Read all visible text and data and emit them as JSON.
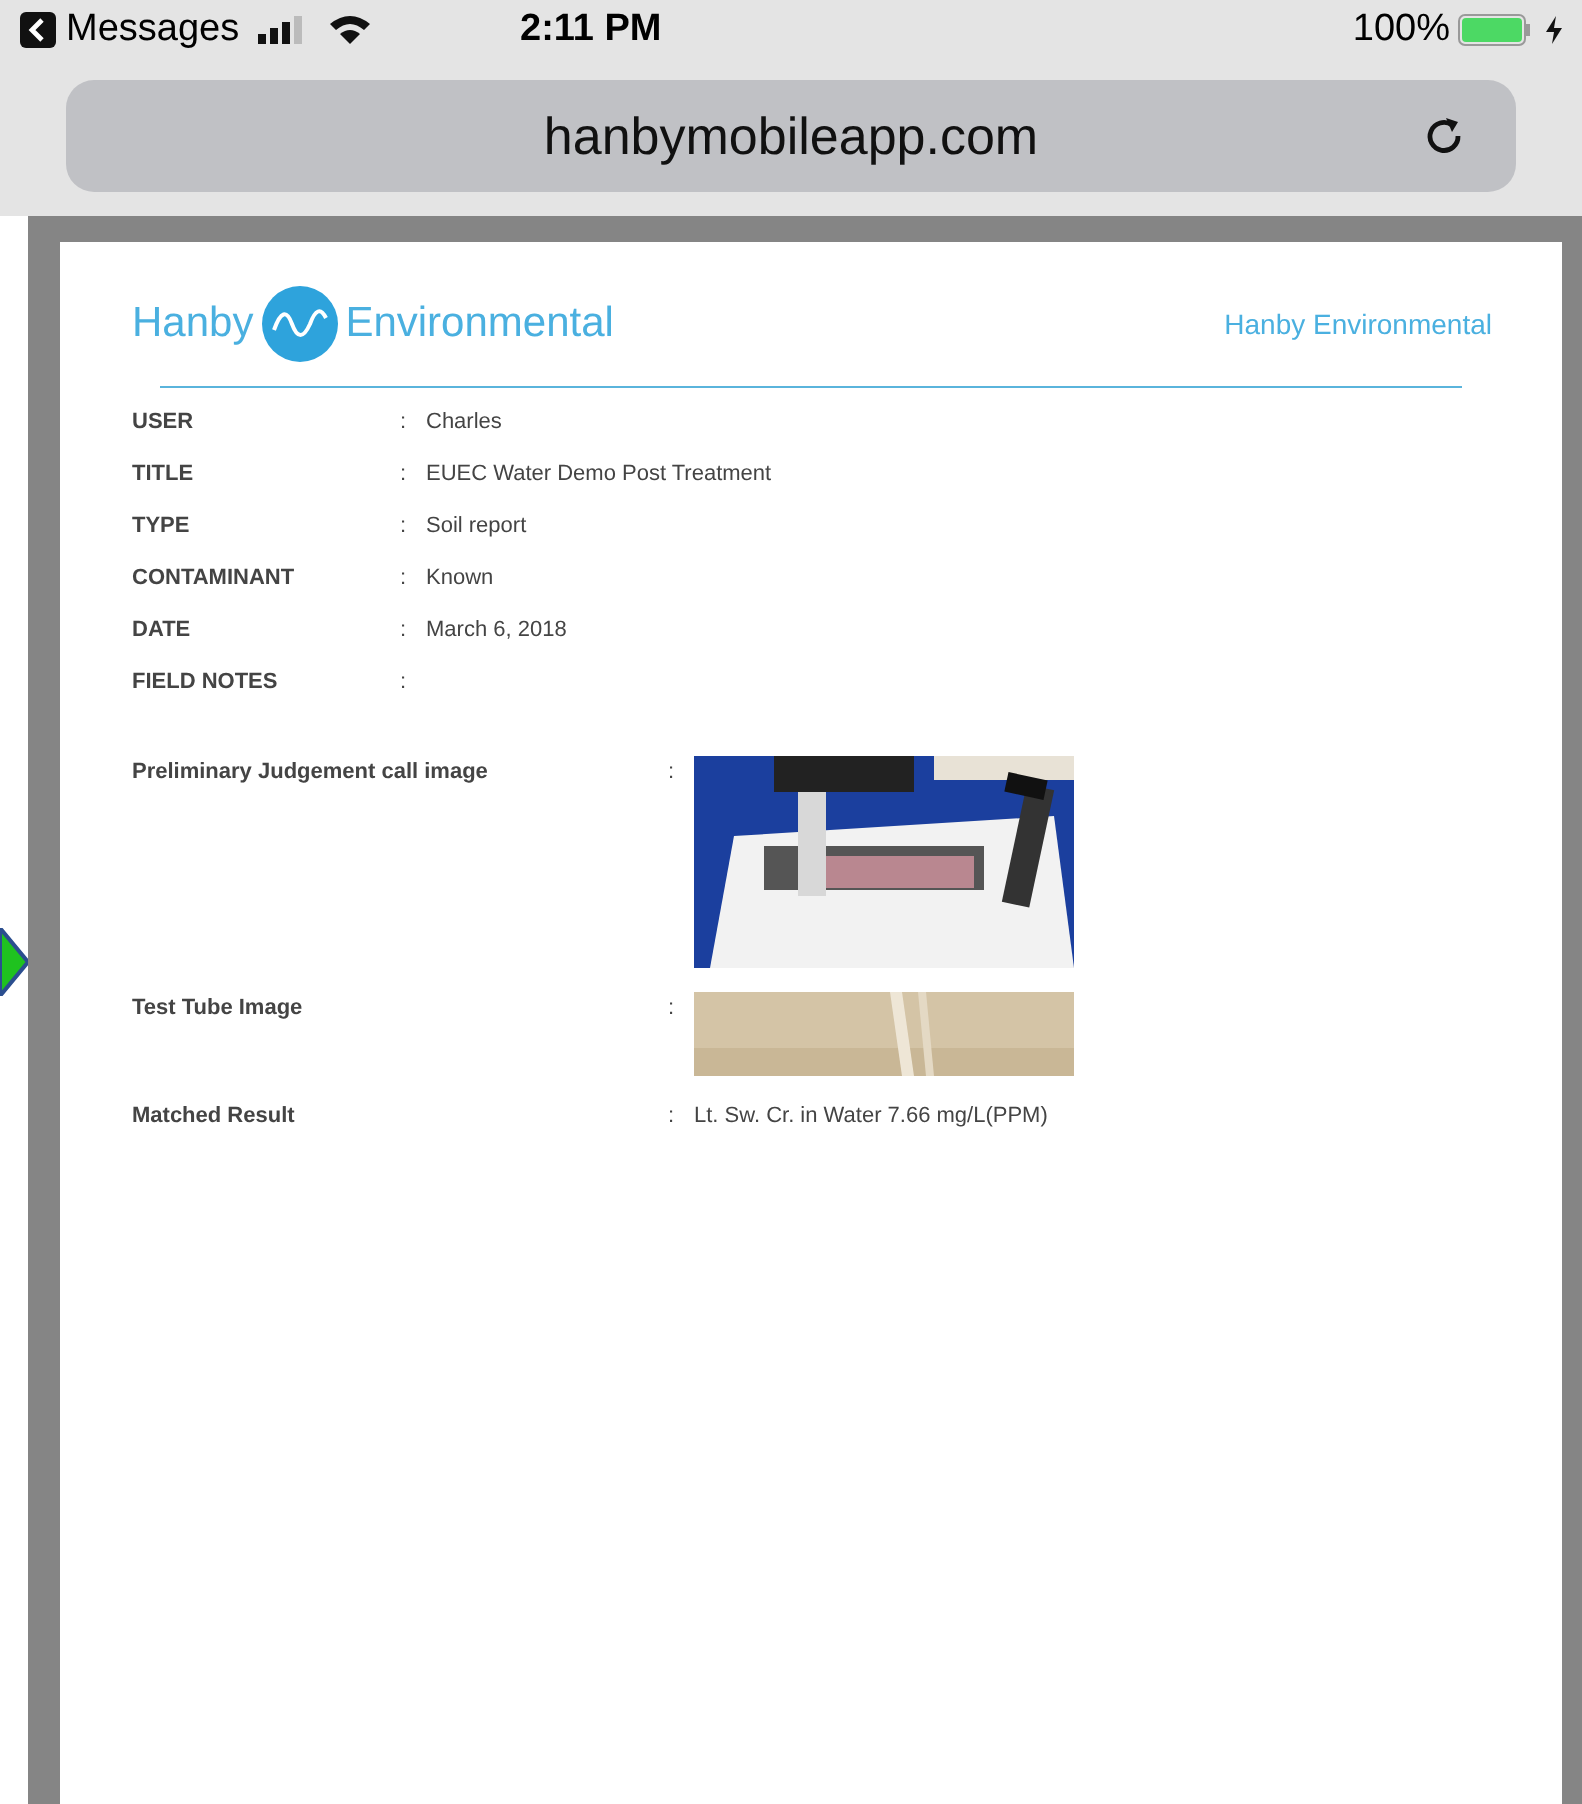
{
  "status_bar": {
    "back_app": "Messages",
    "time": "2:11 PM",
    "battery": "100%"
  },
  "address_bar": {
    "url": "hanbymobileapp.com"
  },
  "report": {
    "logo": {
      "left": "Hanby",
      "right": "Environmental"
    },
    "header_title": "Hanby Environmental",
    "fields": [
      {
        "label": "USER",
        "separator": ":",
        "value": "Charles"
      },
      {
        "label": "TITLE",
        "separator": ":",
        "value": "EUEC Water Demo Post Treatment"
      },
      {
        "label": "TYPE",
        "separator": ":",
        "value": "Soil report"
      },
      {
        "label": "CONTAMINANT",
        "separator": ":",
        "value": "Known"
      },
      {
        "label": "DATE",
        "separator": ":",
        "value": "March 6, 2018"
      },
      {
        "label": "FIELD NOTES",
        "separator": ":"
      }
    ],
    "results": [
      {
        "kind": "picture",
        "label": "Preliminary Judgement call image",
        "separator": ":"
      },
      {
        "kind": "picture",
        "label": "Test Tube Image",
        "separator": ":"
      },
      {
        "kind": "text",
        "label": "Matched Result",
        "separator": ":",
        "value": "Lt. Sw. Cr. in Water 7.66 mg/L(PPM)"
      }
    ]
  }
}
